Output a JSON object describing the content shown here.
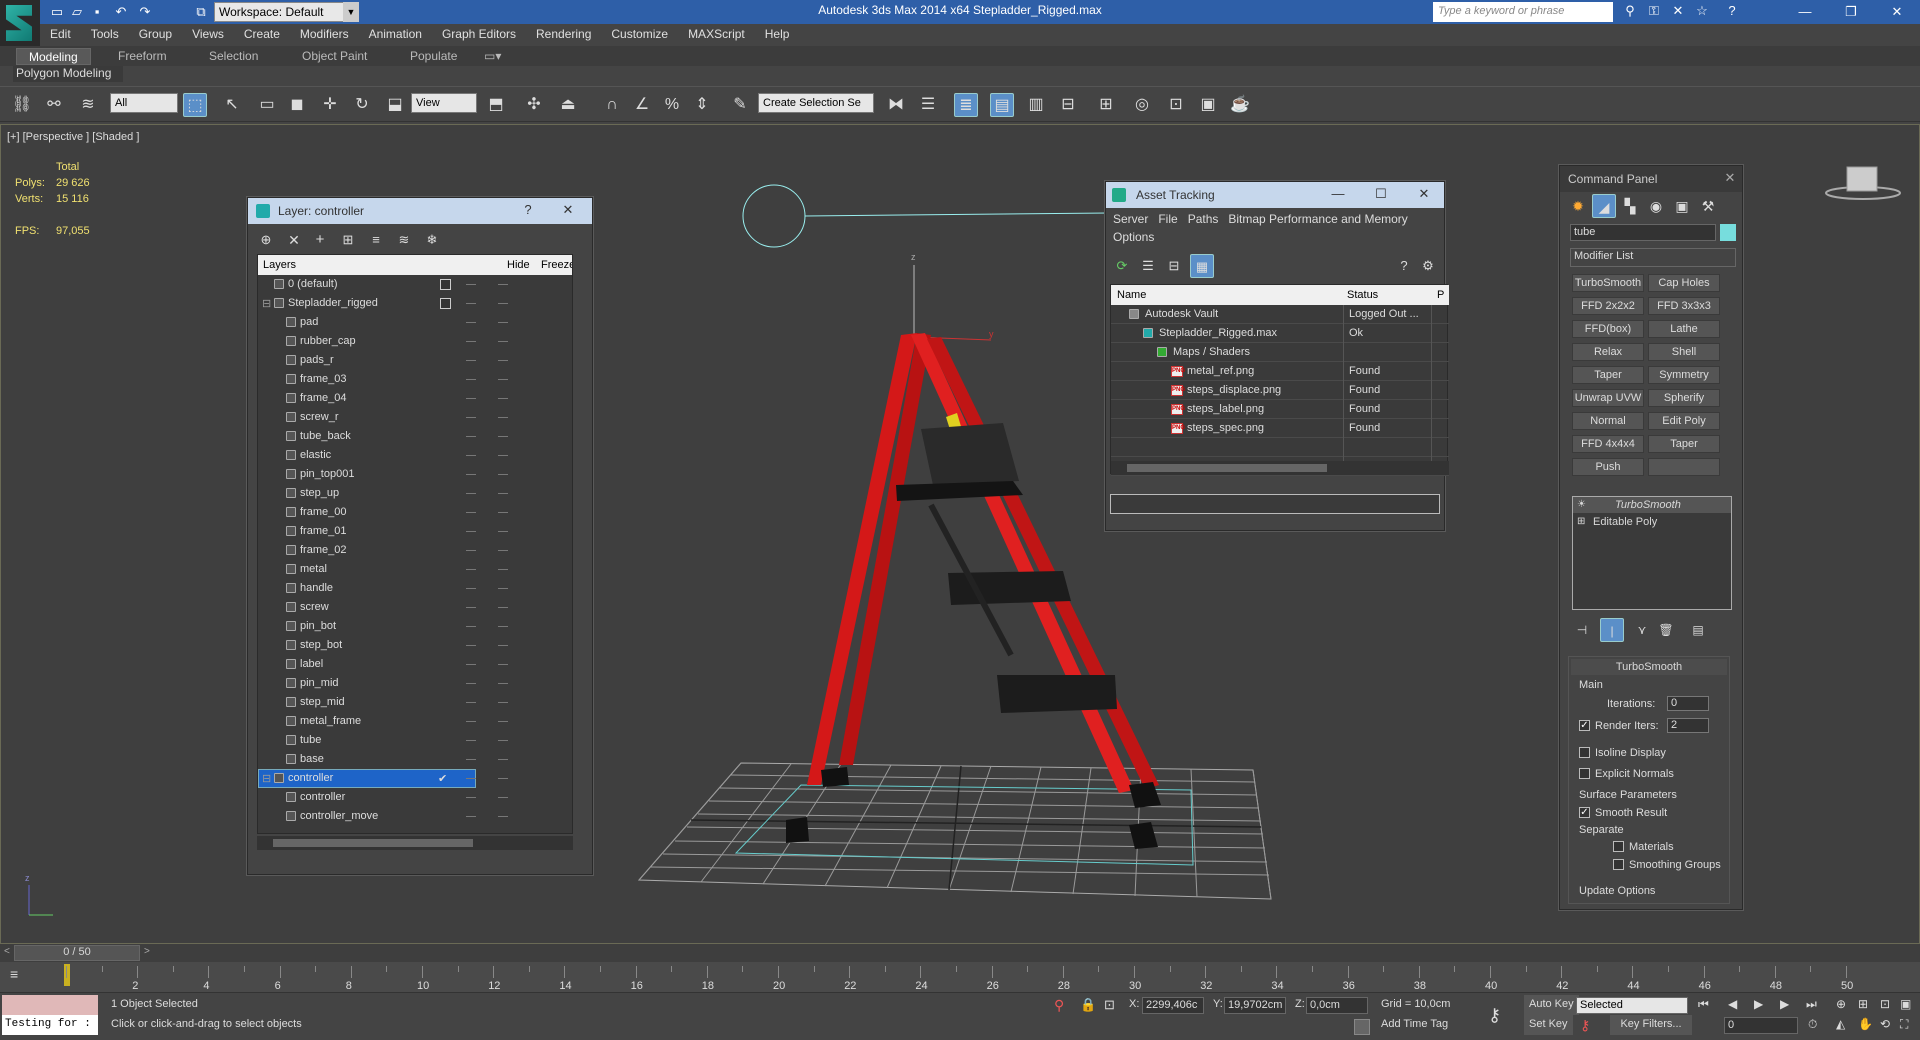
{
  "app": {
    "title": "Autodesk 3ds Max  2014 x64     Stepladder_Rigged.max",
    "workspace": "Workspace: Default",
    "search_placeholder": "Type a keyword or phrase"
  },
  "menu": [
    "Edit",
    "Tools",
    "Group",
    "Views",
    "Create",
    "Modifiers",
    "Animation",
    "Graph Editors",
    "Rendering",
    "Customize",
    "MAXScript",
    "Help"
  ],
  "ribbon": {
    "tabs": [
      "Modeling",
      "Freeform",
      "Selection",
      "Object Paint",
      "Populate"
    ],
    "active": "Modeling",
    "sublabel": "Polygon Modeling"
  },
  "toolbar": {
    "filter": "All",
    "refcoord": "View",
    "selset": "Create Selection Se"
  },
  "viewport": {
    "label": "[+] [Perspective ] [Shaded ]",
    "stats": {
      "total_label": "Total",
      "polys_label": "Polys:",
      "polys": "29 626",
      "verts_label": "Verts:",
      "verts": "15 116",
      "fps_label": "FPS:",
      "fps": "97,055"
    }
  },
  "layer_panel": {
    "title": "Layer: controller",
    "col_layers": "Layers",
    "col_hide": "Hide",
    "col_freeze": "Freeze",
    "rows": [
      {
        "name": "0 (default)",
        "level": 0,
        "kind": "layer"
      },
      {
        "name": "Stepladder_rigged",
        "level": 0,
        "kind": "layer"
      },
      {
        "name": "pad",
        "level": 1,
        "kind": "obj"
      },
      {
        "name": "rubber_cap",
        "level": 1,
        "kind": "obj"
      },
      {
        "name": "pads_r",
        "level": 1,
        "kind": "obj"
      },
      {
        "name": "frame_03",
        "level": 1,
        "kind": "obj"
      },
      {
        "name": "frame_04",
        "level": 1,
        "kind": "obj"
      },
      {
        "name": "screw_r",
        "level": 1,
        "kind": "obj"
      },
      {
        "name": "tube_back",
        "level": 1,
        "kind": "obj"
      },
      {
        "name": "elastic",
        "level": 1,
        "kind": "obj"
      },
      {
        "name": "pin_top001",
        "level": 1,
        "kind": "obj"
      },
      {
        "name": "step_up",
        "level": 1,
        "kind": "obj"
      },
      {
        "name": "frame_00",
        "level": 1,
        "kind": "obj"
      },
      {
        "name": "frame_01",
        "level": 1,
        "kind": "obj"
      },
      {
        "name": "frame_02",
        "level": 1,
        "kind": "obj"
      },
      {
        "name": "metal",
        "level": 1,
        "kind": "obj"
      },
      {
        "name": "handle",
        "level": 1,
        "kind": "obj"
      },
      {
        "name": "screw",
        "level": 1,
        "kind": "obj"
      },
      {
        "name": "pin_bot",
        "level": 1,
        "kind": "obj"
      },
      {
        "name": "step_bot",
        "level": 1,
        "kind": "obj"
      },
      {
        "name": "label",
        "level": 1,
        "kind": "obj"
      },
      {
        "name": "pin_mid",
        "level": 1,
        "kind": "obj"
      },
      {
        "name": "step_mid",
        "level": 1,
        "kind": "obj"
      },
      {
        "name": "metal_frame",
        "level": 1,
        "kind": "obj"
      },
      {
        "name": "tube",
        "level": 1,
        "kind": "obj"
      },
      {
        "name": "base",
        "level": 1,
        "kind": "obj"
      },
      {
        "name": "controller",
        "level": 0,
        "kind": "layer",
        "selected": true
      },
      {
        "name": "controller",
        "level": 1,
        "kind": "obj"
      },
      {
        "name": "controller_move",
        "level": 1,
        "kind": "obj"
      }
    ]
  },
  "asset_panel": {
    "title": "Asset Tracking",
    "menu": [
      "Server",
      "File",
      "Paths",
      "Bitmap Performance and Memory"
    ],
    "menu2": "Options",
    "col_name": "Name",
    "col_status": "Status",
    "col_p": "P",
    "rows": [
      {
        "name": "Autodesk Vault",
        "status": "Logged Out ...",
        "indent": 1,
        "icon": "vault"
      },
      {
        "name": "Stepladder_Rigged.max",
        "status": "Ok",
        "indent": 2,
        "icon": "max"
      },
      {
        "name": "Maps / Shaders",
        "status": "",
        "indent": 3,
        "icon": "maps"
      },
      {
        "name": "metal_ref.png",
        "status": "Found",
        "indent": 4,
        "icon": "png"
      },
      {
        "name": "steps_displace.png",
        "status": "Found",
        "indent": 4,
        "icon": "png"
      },
      {
        "name": "steps_label.png",
        "status": "Found",
        "indent": 4,
        "icon": "png"
      },
      {
        "name": "steps_spec.png",
        "status": "Found",
        "indent": 4,
        "icon": "png"
      }
    ]
  },
  "command_panel": {
    "title": "Command Panel",
    "object_name": "tube",
    "modifier_list": "Modifier List",
    "buttons": [
      "TurboSmooth",
      "Cap Holes",
      "FFD 2x2x2",
      "FFD 3x3x3",
      "FFD(box)",
      "Lathe",
      "Relax",
      "Shell",
      "Taper",
      "Symmetry",
      "Unwrap UVW",
      "Spherify",
      "Normal",
      "Edit Poly",
      "FFD 4x4x4",
      "Taper",
      "Push",
      ""
    ],
    "stack": [
      "TurboSmooth",
      "Editable Poly"
    ],
    "rollout_title": "TurboSmooth",
    "main_label": "Main",
    "iterations_label": "Iterations:",
    "iterations": "0",
    "render_iters_label": "Render Iters:",
    "render_iters": "2",
    "isoline": "Isoline Display",
    "explicit": "Explicit Normals",
    "surface": "Surface Parameters",
    "smooth": "Smooth Result",
    "separate": "Separate",
    "materials": "Materials",
    "smoothing": "Smoothing Groups",
    "update": "Update Options"
  },
  "timeline": {
    "frame": "0 / 50",
    "ticks": [
      "2",
      "4",
      "6",
      "8",
      "10",
      "12",
      "14",
      "16",
      "18",
      "20",
      "22",
      "24",
      "26",
      "28",
      "30",
      "32",
      "34",
      "36",
      "38",
      "40",
      "42",
      "44",
      "46",
      "48",
      "50"
    ]
  },
  "status": {
    "script": "Testing for :",
    "selected": "1 Object Selected",
    "prompt": "Click or click-and-drag to select objects",
    "x_label": "X:",
    "x": "2299,406c",
    "y_label": "Y:",
    "y": "19,9702cm",
    "z_label": "Z:",
    "z": "0,0cm",
    "grid": "Grid = 10,0cm",
    "add_time_tag": "Add Time Tag",
    "auto_key": "Auto Key",
    "set_key": "Set Key",
    "key_mode": "Selected",
    "key_filters": "Key Filters...",
    "frame_val": "0"
  }
}
